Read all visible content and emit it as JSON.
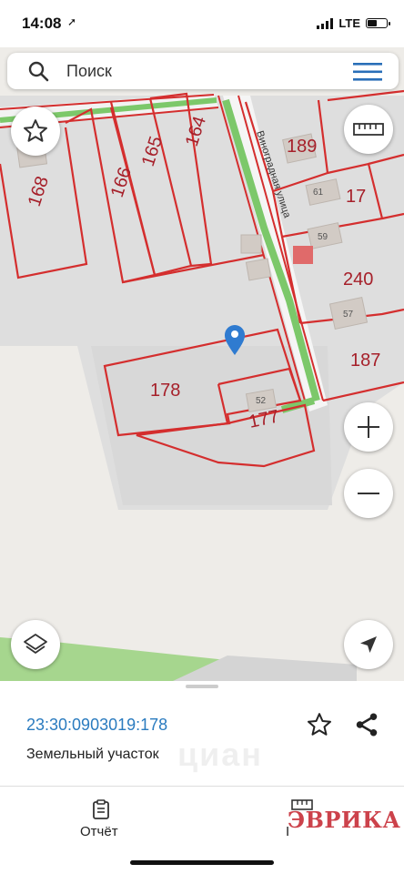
{
  "status_bar": {
    "time": "14:08",
    "network": "LTE"
  },
  "search": {
    "placeholder": "Поиск"
  },
  "map": {
    "street_name": "Виноградная улица",
    "parcels": [
      {
        "id": "p168",
        "label": "168"
      },
      {
        "id": "p166",
        "label": "166"
      },
      {
        "id": "p165",
        "label": "165"
      },
      {
        "id": "p164",
        "label": "164"
      },
      {
        "id": "p189",
        "label": "189"
      },
      {
        "id": "p17",
        "label": "17"
      },
      {
        "id": "p240",
        "label": "240"
      },
      {
        "id": "p187",
        "label": "187"
      },
      {
        "id": "p178",
        "label": "178"
      },
      {
        "id": "p177",
        "label": "177"
      }
    ],
    "house_numbers": [
      "61",
      "59",
      "57",
      "52"
    ]
  },
  "parcel_info": {
    "cadastral_number": "23:30:0903019:178",
    "type": "Земельный участок"
  },
  "bottom_nav": {
    "report_label": "Отчёт",
    "measure_label": "I"
  },
  "watermark": {
    "logo_text": "ЭВРИКА",
    "brand_text": "циан"
  },
  "colors": {
    "parcel_border": "#d42e2e",
    "road_green": "#7cc86a",
    "link_blue": "#2a7bbf",
    "pin_blue": "#2f7bd0"
  }
}
